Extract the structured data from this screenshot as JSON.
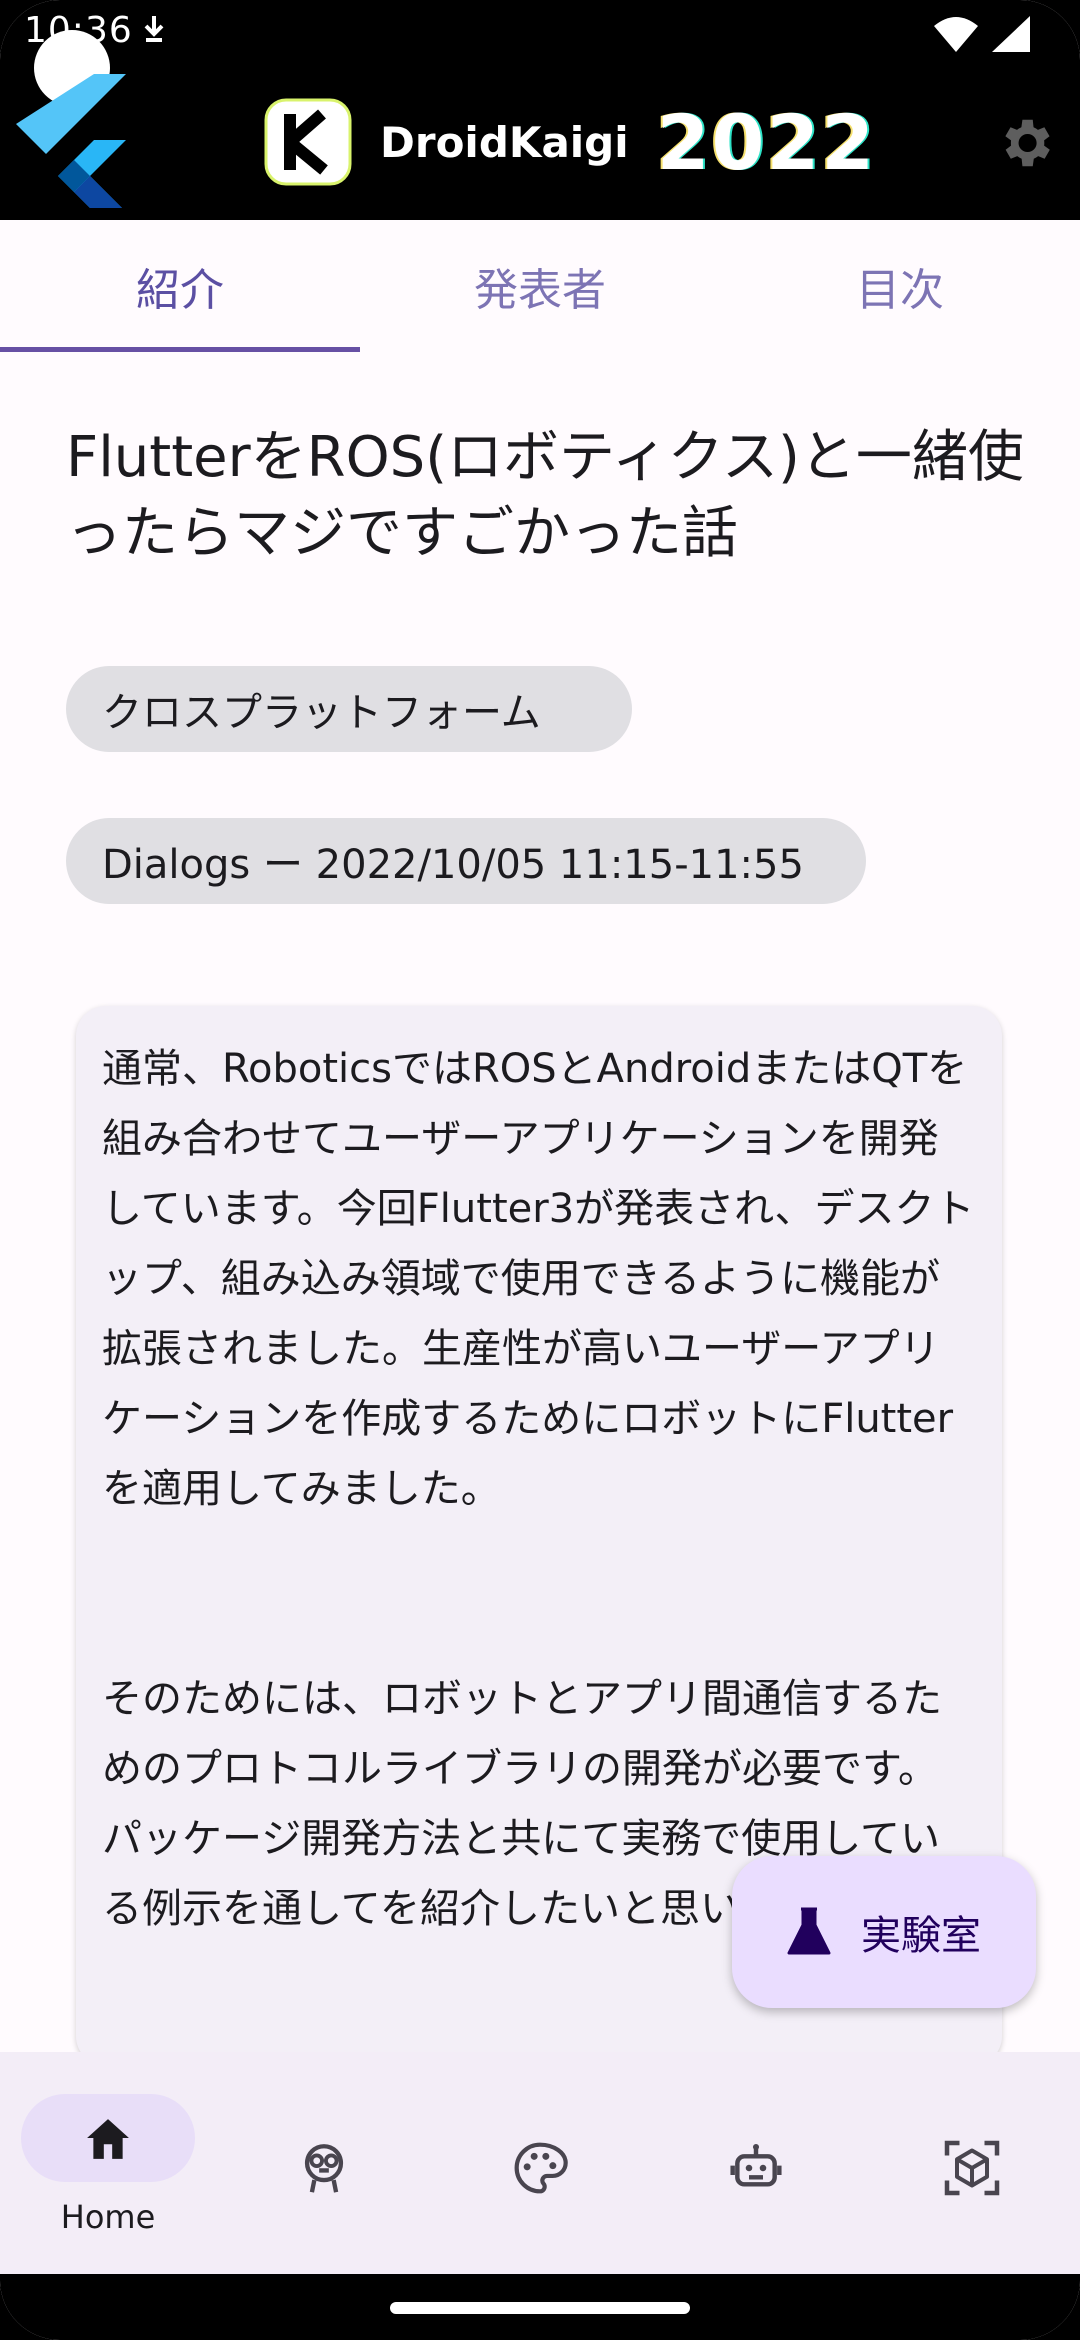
{
  "status": {
    "time": "10:36",
    "extra_icon": "download-icon"
  },
  "app": {
    "brand_name": "DroidKaigi",
    "brand_year": "2022"
  },
  "tabs": [
    {
      "label": "紹介",
      "active": true
    },
    {
      "label": "発表者",
      "active": false
    },
    {
      "label": "目次",
      "active": false
    }
  ],
  "session": {
    "title": "FlutterをROS(ロボティクス)と一緒使ったらマジですごかった話",
    "category": "クロスプラットフォーム",
    "room_time": "Dialogs ー 2022/10/05 11:15-11:55",
    "description": [
      "通常、RoboticsではROSとAndroidまたはQTを組み合わせてユーザーアプリケーションを開発しています。今回Flutter3が発表され、デスクトップ、組み込み領域で使用できるように機能が拡張されました。生産性が高いユーザーアプリケーションを作成するためにロボットにFlutterを適用してみました。",
      "そのためには、ロボットとアプリ間通信するためのプロトコルライブラリの開発が必要です。パッケージ開発方法と共にて実務で使用している例示を通してを紹介したいと思います。"
    ]
  },
  "fab": {
    "label": "実験室",
    "icon": "flask-icon"
  },
  "bottom_nav": [
    {
      "label": "Home",
      "icon": "home-icon",
      "active": true
    },
    {
      "label": "",
      "icon": "mascot-icon",
      "active": false
    },
    {
      "label": "",
      "icon": "palette-icon",
      "active": false
    },
    {
      "label": "",
      "icon": "robot-icon",
      "active": false
    },
    {
      "label": "",
      "icon": "ar-cube-icon",
      "active": false
    }
  ],
  "colors": {
    "primary": "#6750a4",
    "tab_inactive": "#7d74b4",
    "fab_bg": "#eaddff",
    "card_bg": "#f3eff7",
    "chip_bg": "#e0dfe3",
    "nav_bg": "#f3edf7"
  }
}
